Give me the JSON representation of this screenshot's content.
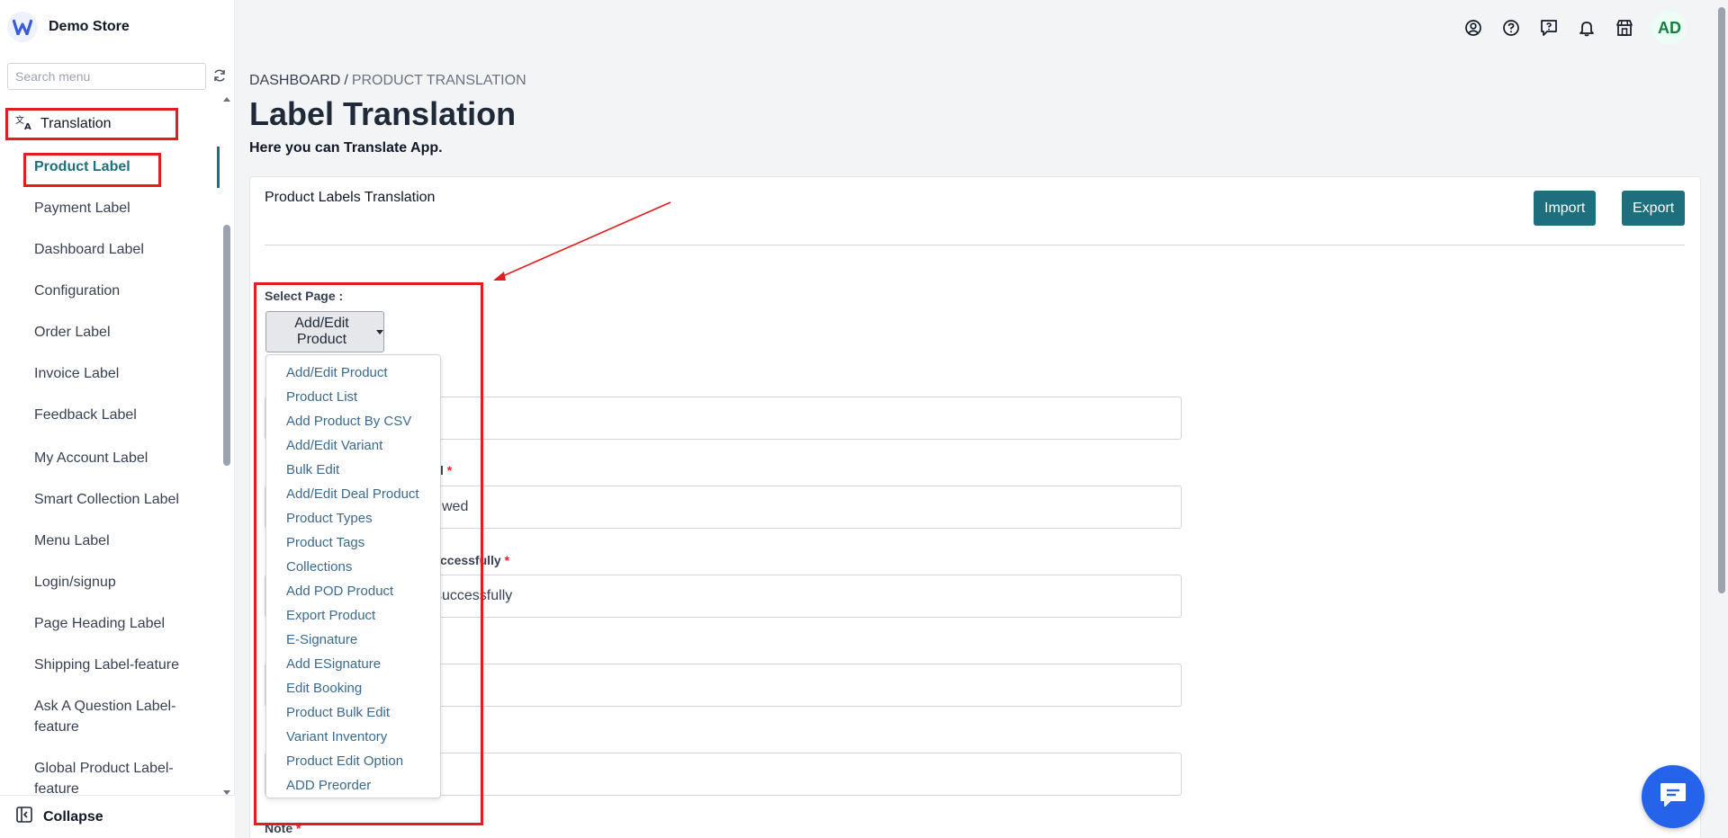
{
  "sidebar": {
    "brand": "Demo Store",
    "search_placeholder": "Search menu",
    "section": "Translation",
    "items": [
      {
        "label": "Product Label",
        "active": true
      },
      {
        "label": "Payment Label"
      },
      {
        "label": "Dashboard Label"
      },
      {
        "label": "Configuration"
      },
      {
        "label": "Order Label"
      },
      {
        "label": "Invoice Label"
      },
      {
        "label": "Feedback Label"
      },
      {
        "label": "My Account Label"
      },
      {
        "label": "Smart Collection Label"
      },
      {
        "label": "Menu Label"
      },
      {
        "label": "Login/signup"
      },
      {
        "label": "Page Heading Label"
      },
      {
        "label": "Shipping Label-feature"
      },
      {
        "label": "Ask A Question Label-feature"
      },
      {
        "label": "Global Product Label-feature"
      }
    ],
    "collapse_label": "Collapse"
  },
  "topbar": {
    "icons": [
      "user-circle-icon",
      "help-circle-icon",
      "feedback-icon",
      "bell-icon",
      "store-icon"
    ],
    "avatar": "AD"
  },
  "breadcrumb": {
    "root": "DASHBOARD",
    "separator": "/",
    "current": "PRODUCT TRANSLATION"
  },
  "page": {
    "title": "Label Translation",
    "subtitle": "Here you can Translate App."
  },
  "card": {
    "title": "Product Labels Translation",
    "import_label": "Import",
    "export_label": "Export",
    "select_label": "Select Page :",
    "selected_page": "Add/Edit Product",
    "page_options": [
      "Add/Edit Product",
      "Product List",
      "Add Product By CSV",
      "Add/Edit Variant",
      "Bulk Edit",
      "Add/Edit Deal Product",
      "Product Types",
      "Product Tags",
      "Collections",
      "Add POD Product",
      "Export Product",
      "E-Signature",
      "Add ESignature",
      "Edit Booking",
      "Product Bulk Edit",
      "Variant Inventory",
      "Product Edit Option",
      "ADD Preorder"
    ],
    "fields": [
      {
        "label_tail": "",
        "value_tail": ""
      },
      {
        "label_tail": "l",
        "value_tail": "wed"
      },
      {
        "label_tail": "ccessfully",
        "value_tail": "successfully"
      },
      {
        "label_tail": "",
        "value_tail": ""
      },
      {
        "label_tail": "",
        "value_tail": ""
      }
    ],
    "note_label": "Note",
    "required_mark": "*"
  },
  "colors": {
    "accent": "#1e6f7e",
    "highlight": "#e11d1d",
    "link": "#3b6a8c",
    "chat": "#2563eb"
  }
}
